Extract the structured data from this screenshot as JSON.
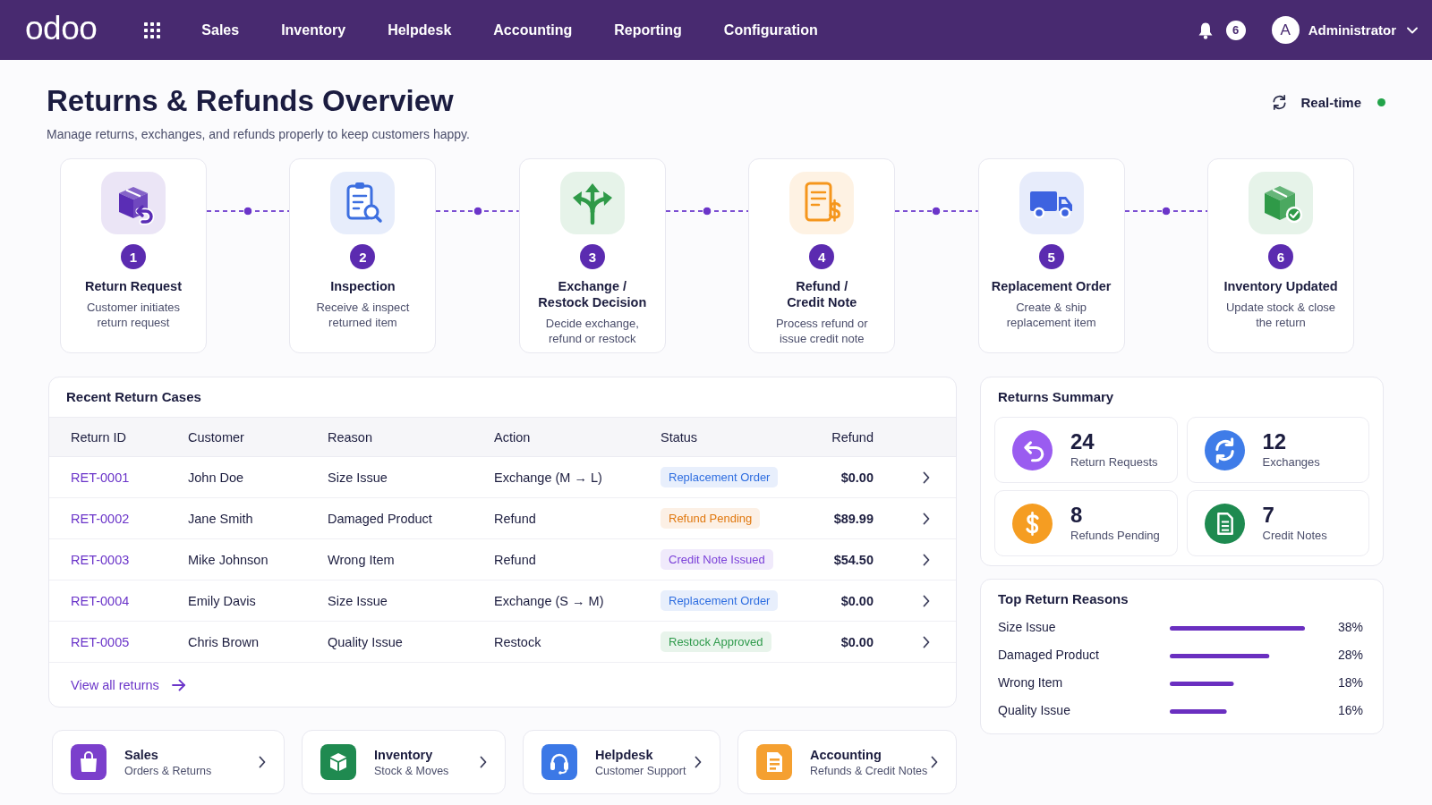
{
  "navbar": {
    "logo": "odoo",
    "menu": [
      "Sales",
      "Inventory",
      "Helpdesk",
      "Accounting",
      "Reporting",
      "Configuration"
    ],
    "notifications": "6",
    "avatar": "A",
    "user": "Administrator"
  },
  "header": {
    "title": "Returns & Refunds Overview",
    "subtitle": "Manage returns, exchanges, and refunds properly to keep customers happy.",
    "realtime": {
      "label": "Real-time",
      "live": true
    }
  },
  "workflow": [
    {
      "kind": "return",
      "color": "#5a2db5",
      "number": "1",
      "title": "Return Request",
      "description": "Customer initiates\nreturn request"
    },
    {
      "kind": "inspect",
      "color": "#3d6fe0",
      "number": "2",
      "title": "Inspection",
      "description": "Receive & inspect\nreturned item"
    },
    {
      "kind": "decision",
      "color": "#2f9a48",
      "number": "3",
      "title": "Exchange /\nRestock Decision",
      "description": "Decide exchange,\nrefund or restock"
    },
    {
      "kind": "refund",
      "color": "#f5961c",
      "number": "4",
      "title": "Refund /\nCredit Note",
      "description": "Process refund or\nissue credit note"
    },
    {
      "kind": "ship",
      "color": "#3d63e0",
      "number": "5",
      "title": "Replacement Order",
      "description": "Create & ship\nreplacement item"
    },
    {
      "kind": "stock",
      "color": "#2f9a48",
      "number": "6",
      "title": "Inventory Updated",
      "description": "Update stock & close\nthe return"
    }
  ],
  "recent_cases": {
    "title": "Recent Return Cases",
    "columns": [
      "Return ID",
      "Customer",
      "Reason",
      "Action",
      "Status",
      "Refund"
    ],
    "rows": [
      {
        "id": "RET-0001",
        "customer": "John Doe",
        "reason": "Size Issue",
        "action": "Exchange (M → L)",
        "status": {
          "label": "Replacement Order",
          "color": "#2f6ee0"
        },
        "refund": "$0.00"
      },
      {
        "id": "RET-0002",
        "customer": "Jane Smith",
        "reason": "Damaged Product",
        "action": "Refund",
        "status": {
          "label": "Refund Pending",
          "color": "#e0780f"
        },
        "refund": "$89.99"
      },
      {
        "id": "RET-0003",
        "customer": "Mike Johnson",
        "reason": "Wrong Item",
        "action": "Refund",
        "status": {
          "label": "Credit Note Issued",
          "color": "#7a3fd8"
        },
        "refund": "$54.50"
      },
      {
        "id": "RET-0004",
        "customer": "Emily Davis",
        "reason": "Size Issue",
        "action": "Exchange (S → M)",
        "status": {
          "label": "Replacement Order",
          "color": "#2f6ee0"
        },
        "refund": "$0.00"
      },
      {
        "id": "RET-0005",
        "customer": "Chris Brown",
        "reason": "Quality Issue",
        "action": "Restock",
        "status": {
          "label": "Restock Approved",
          "color": "#2e9a4b"
        },
        "refund": "$0.00"
      }
    ],
    "view_all": "View all returns"
  },
  "returns_summary": {
    "title": "Returns Summary",
    "stats": [
      {
        "kind": "return",
        "color": "#9a5cf0",
        "value": "24",
        "label": "Return Requests"
      },
      {
        "kind": "exchange",
        "color": "#3f7ce8",
        "value": "12",
        "label": "Exchanges"
      },
      {
        "kind": "refund",
        "color": "#f59d22",
        "value": "8",
        "label": "Refunds Pending"
      },
      {
        "kind": "credit",
        "color": "#1e8a50",
        "value": "7",
        "label": "Credit Notes"
      }
    ]
  },
  "top_reasons": {
    "title": "Top Return Reasons",
    "chart_data": {
      "type": "bar",
      "orientation": "horizontal",
      "categories": [
        "Size Issue",
        "Damaged Product",
        "Wrong Item",
        "Quality Issue"
      ],
      "values": [
        38,
        28,
        18,
        16
      ],
      "value_labels": [
        "38%",
        "28%",
        "18%",
        "16%"
      ]
    }
  },
  "apps": [
    {
      "kind": "sales",
      "color": "#7b3fcc",
      "title": "Sales",
      "subtitle": "Orders & Returns"
    },
    {
      "kind": "inventory",
      "color": "#1f8a50",
      "title": "Inventory",
      "subtitle": "Stock & Moves"
    },
    {
      "kind": "helpdesk",
      "color": "#3b78e6",
      "title": "Helpdesk",
      "subtitle": "Customer Support"
    },
    {
      "kind": "accounting",
      "color": "#f5a030",
      "title": "Accounting",
      "subtitle": "Refunds & Credit Notes"
    }
  ]
}
